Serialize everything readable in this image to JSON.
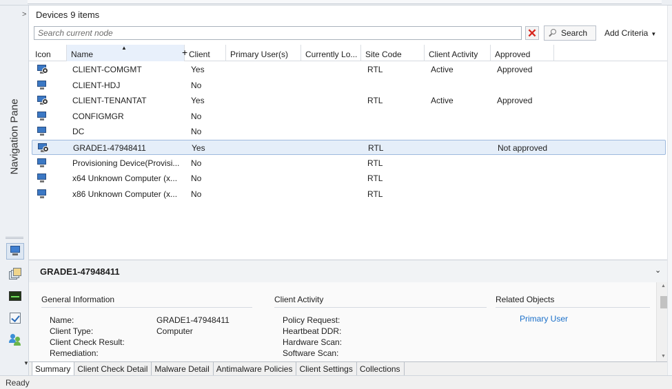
{
  "header": {
    "breadcrumb_chevron": ">",
    "title": "Devices",
    "count": "9 items"
  },
  "search": {
    "placeholder": "Search current node",
    "clear_icon": "red-x-icon",
    "search_label": "Search",
    "add_criteria_label": "Add Criteria"
  },
  "nav": {
    "label": "Navigation Pane",
    "icons": [
      "assets-icon",
      "software-library-icon",
      "monitoring-icon",
      "administration-icon",
      "community-icon"
    ]
  },
  "grid": {
    "columns": [
      "Icon",
      "Name",
      "Client",
      "Primary User(s)",
      "Currently Lo...",
      "Site Code",
      "Client Activity",
      "Approved"
    ],
    "sorted_column": "Name",
    "rows": [
      {
        "name": "CLIENT-COMGMT",
        "client": "Yes",
        "primary_users": "",
        "currently_logged": "",
        "site_code": "RTL",
        "client_activity": "Active",
        "approved": "Approved",
        "icon": "managed-computer-icon"
      },
      {
        "name": "CLIENT-HDJ",
        "client": "No",
        "primary_users": "",
        "currently_logged": "",
        "site_code": "",
        "client_activity": "",
        "approved": "",
        "icon": "computer-icon"
      },
      {
        "name": "CLIENT-TENANTAT",
        "client": "Yes",
        "primary_users": "",
        "currently_logged": "",
        "site_code": "RTL",
        "client_activity": "Active",
        "approved": "Approved",
        "icon": "managed-computer-icon"
      },
      {
        "name": "CONFIGMGR",
        "client": "No",
        "primary_users": "",
        "currently_logged": "",
        "site_code": "",
        "client_activity": "",
        "approved": "",
        "icon": "computer-icon"
      },
      {
        "name": "DC",
        "client": "No",
        "primary_users": "",
        "currently_logged": "",
        "site_code": "",
        "client_activity": "",
        "approved": "",
        "icon": "computer-icon"
      },
      {
        "name": "GRADE1-47948411",
        "client": "Yes",
        "primary_users": "",
        "currently_logged": "",
        "site_code": "RTL",
        "client_activity": "",
        "approved": "Not approved",
        "icon": "managed-computer-icon",
        "selected": true
      },
      {
        "name": "Provisioning Device(Provisi...",
        "client": "No",
        "primary_users": "",
        "currently_logged": "",
        "site_code": "RTL",
        "client_activity": "",
        "approved": "",
        "icon": "computer-icon"
      },
      {
        "name": "x64 Unknown Computer (x...",
        "client": "No",
        "primary_users": "",
        "currently_logged": "",
        "site_code": "RTL",
        "client_activity": "",
        "approved": "",
        "icon": "computer-icon"
      },
      {
        "name": "x86 Unknown Computer (x...",
        "client": "No",
        "primary_users": "",
        "currently_logged": "",
        "site_code": "RTL",
        "client_activity": "",
        "approved": "",
        "icon": "computer-icon"
      }
    ]
  },
  "details": {
    "title": "GRADE1-47948411",
    "sections": {
      "general": "General Information",
      "activity": "Client Activity",
      "related": "Related Objects"
    },
    "general": [
      {
        "key": "Name:",
        "value": "GRADE1-47948411"
      },
      {
        "key": "Client Type:",
        "value": "Computer"
      },
      {
        "key": "Client Check Result:",
        "value": ""
      },
      {
        "key": "Remediation:",
        "value": ""
      }
    ],
    "activity": [
      "Policy Request:",
      "Heartbeat DDR:",
      "Hardware Scan:",
      "Software Scan:"
    ],
    "related_link": "Primary User"
  },
  "tabs": [
    "Summary",
    "Client Check Detail",
    "Malware Detail",
    "Antimalware Policies",
    "Client Settings",
    "Collections"
  ],
  "active_tab": "Summary",
  "status": "Ready",
  "colors": {
    "selection": "#e5eef9",
    "link": "#1a6fc9",
    "accent": "#3b78c4"
  }
}
